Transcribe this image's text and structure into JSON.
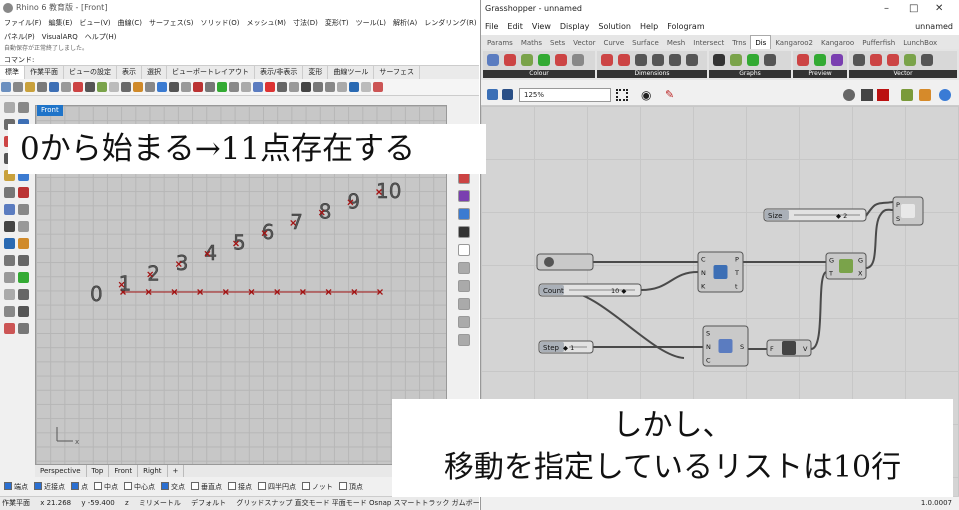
{
  "rhino": {
    "title": "Rhino 6 教育版 - [Front]",
    "menu1": [
      "ファイル(F)",
      "編集(E)",
      "ビュー(V)",
      "曲線(C)",
      "サーフェス(S)",
      "ソリッド(O)",
      "メッシュ(M)",
      "寸法(D)",
      "変形(T)",
      "ツール(L)",
      "解析(A)",
      "レンダリング(R)"
    ],
    "menu2": [
      "パネル(P)",
      "VisualARQ",
      "ヘルプ(H)"
    ],
    "command_history": "自動保存が正常終了しました。",
    "command_label": "コマンド:",
    "toolbar_tabs": [
      "標準",
      "作業平面",
      "ビューの設定",
      "表示",
      "選択",
      "ビューポートレイアウト",
      "表示/非表示",
      "変形",
      "曲線ツール",
      "サーフェス"
    ],
    "viewport_label": "Front",
    "viewport_tabs": [
      "Perspective",
      "Top",
      "Front",
      "Right"
    ],
    "osnaps": [
      {
        "label": "端点",
        "on": true
      },
      {
        "label": "近接点",
        "on": true
      },
      {
        "label": "点",
        "on": true
      },
      {
        "label": "中点",
        "on": false
      },
      {
        "label": "中心点",
        "on": false
      },
      {
        "label": "交点",
        "on": true
      },
      {
        "label": "垂直点",
        "on": false
      },
      {
        "label": "接点",
        "on": false
      },
      {
        "label": "四半円点",
        "on": false
      },
      {
        "label": "ノット",
        "on": false
      },
      {
        "label": "頂点",
        "on": false
      }
    ],
    "status": {
      "plane": "作業平面",
      "x": "x 21.268",
      "y": "y -59.400",
      "z": "z",
      "units": "ミリメートル",
      "layer": "デフォルト",
      "modes": "グリッドスナップ 直交モード 平面モード Osnap スマートトラック ガムボール ヒストリを記録"
    },
    "point_labels": [
      "0",
      "1",
      "2",
      "3",
      "4",
      "5",
      "6",
      "7",
      "8",
      "9",
      "10"
    ],
    "point_marker_count": 11
  },
  "grasshopper": {
    "title": "Grasshopper - unnamed",
    "document_name": "unnamed",
    "menu": [
      "File",
      "Edit",
      "View",
      "Display",
      "Solution",
      "Help",
      "Fologram"
    ],
    "tabs": [
      "Params",
      "Maths",
      "Sets",
      "Vector",
      "Curve",
      "Surface",
      "Mesh",
      "Intersect",
      "Trns",
      "Dis",
      "Kangaroo2",
      "Kangaroo",
      "Pufferfish",
      "LunchBox"
    ],
    "active_tab": "Dis",
    "ribbon_groups": [
      "Colour",
      "Dimensions",
      "Graphs",
      "Preview",
      "Vector"
    ],
    "zoom": "125%",
    "version": "1.0.0007",
    "components": {
      "slider_size": {
        "label": "Size",
        "value": "◆ 2"
      },
      "slider_count": {
        "label": "Count",
        "value": "10 ◆"
      },
      "slider_step": {
        "label": "Step",
        "value": "◆ 1"
      },
      "divide": {
        "inputs": [
          "C",
          "N",
          "K"
        ],
        "outputs": [
          "P",
          "T",
          "t"
        ]
      },
      "move": {
        "inputs": [
          "G",
          "T"
        ],
        "outputs": [
          "G",
          "X"
        ]
      },
      "series": {
        "inputs": [
          "S",
          "N",
          "C"
        ],
        "outputs": [
          "S"
        ]
      },
      "unit": {
        "inputs": [
          "F"
        ],
        "outputs": [
          "V"
        ]
      },
      "tag": {
        "inputs": [
          "P",
          "S"
        ]
      }
    }
  },
  "overlays": {
    "top": "0から始まる→11点存在する",
    "bottom_line1": "しかし、",
    "bottom_line2": "移動を指定しているリストは10行"
  }
}
